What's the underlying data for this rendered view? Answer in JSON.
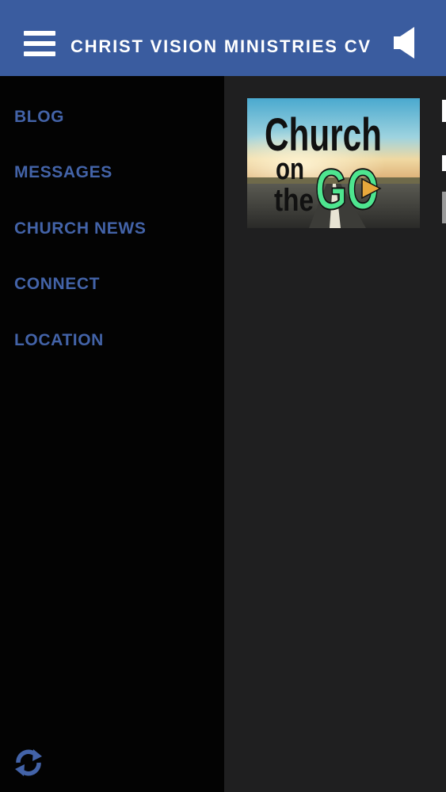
{
  "header": {
    "title": "CHRIST VISION MINISTRIES CV",
    "menu_icon": "hamburger-menu-icon",
    "audio_icon": "speaker-icon"
  },
  "drawer": {
    "items": [
      {
        "label": "BLOG"
      },
      {
        "label": "MESSAGES"
      },
      {
        "label": "CHURCH NEWS"
      },
      {
        "label": "CONNECT"
      },
      {
        "label": "LOCATION"
      }
    ],
    "refresh_icon": "refresh-icon"
  },
  "content": {
    "thumbnail": {
      "line1": "Church",
      "line2": "on",
      "line3": "the",
      "line4": "GO"
    }
  },
  "colors": {
    "header_bg": "#3a5c9f",
    "drawer_bg": "#030303",
    "content_bg": "#1f1f20",
    "nav_text": "#4363a8",
    "go_green": "#4ee58f"
  }
}
